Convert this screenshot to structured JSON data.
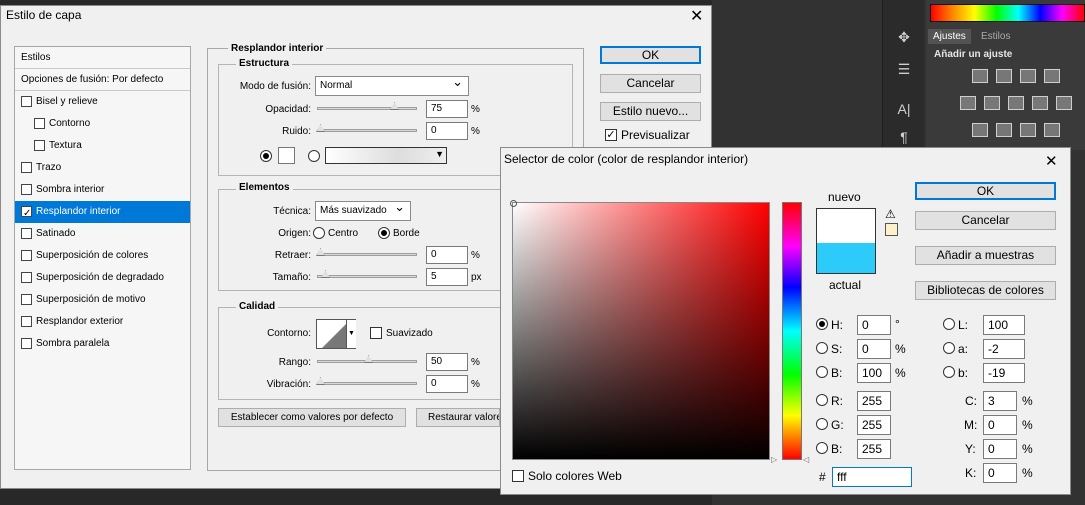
{
  "ps_panel": {
    "tab_ajustes": "Ajustes",
    "tab_estilos": "Estilos",
    "add_adjustment": "Añadir un ajuste"
  },
  "layer_style": {
    "title": "Estilo de capa",
    "styles_header": "Estilos",
    "blend_options": "Opciones de fusión: Por defecto",
    "items": [
      {
        "label": "Bisel y relieve",
        "checked": false
      },
      {
        "label": "Contorno",
        "checked": false
      },
      {
        "label": "Textura",
        "checked": false
      },
      {
        "label": "Trazo",
        "checked": false
      },
      {
        "label": "Sombra interior",
        "checked": false
      },
      {
        "label": "Resplandor interior",
        "checked": true
      },
      {
        "label": "Satinado",
        "checked": false
      },
      {
        "label": "Superposición de colores",
        "checked": false
      },
      {
        "label": "Superposición de degradado",
        "checked": false
      },
      {
        "label": "Superposición de motivo",
        "checked": false
      },
      {
        "label": "Resplandor exterior",
        "checked": false
      },
      {
        "label": "Sombra paralela",
        "checked": false
      }
    ],
    "section_title": "Resplandor interior",
    "structure": {
      "title": "Estructura",
      "blend_mode_label": "Modo de fusión:",
      "blend_mode": "Normal",
      "opacity_label": "Opacidad:",
      "opacity": "75",
      "noise_label": "Ruido:",
      "noise": "0",
      "pct": "%"
    },
    "elements": {
      "title": "Elementos",
      "technique_label": "Técnica:",
      "technique": "Más suavizado",
      "origin_label": "Origen:",
      "origin_center": "Centro",
      "origin_edge": "Borde",
      "choke_label": "Retraer:",
      "choke": "0",
      "size_label": "Tamaño:",
      "size": "5",
      "px": "px",
      "pct": "%"
    },
    "quality": {
      "title": "Calidad",
      "contour_label": "Contorno:",
      "antialias": "Suavizado",
      "range_label": "Rango:",
      "range": "50",
      "jitter_label": "Vibración:",
      "jitter": "0",
      "pct": "%"
    },
    "set_default": "Establecer como valores por defecto",
    "reset_default": "Restaurar valores por defecto",
    "ok": "OK",
    "cancel": "Cancelar",
    "new_style": "Estilo nuevo...",
    "preview": "Previsualizar"
  },
  "color_picker": {
    "title": "Selector de color (color de resplandor interior)",
    "new_label": "nuevo",
    "current_label": "actual",
    "ok": "OK",
    "cancel": "Cancelar",
    "add_swatches": "Añadir a muestras",
    "color_libraries": "Bibliotecas de colores",
    "H": "0",
    "S": "0",
    "B": "100",
    "R": "255",
    "G": "255",
    "Bv": "255",
    "L": "100",
    "a": "-2",
    "b": "-19",
    "C": "3",
    "M": "0",
    "Y": "0",
    "K": "0",
    "hex": "fff",
    "web_only": "Solo colores Web",
    "deg": "°",
    "pct": "%",
    "new_color": "#ffffff",
    "current_color": "#2dcbfa"
  }
}
